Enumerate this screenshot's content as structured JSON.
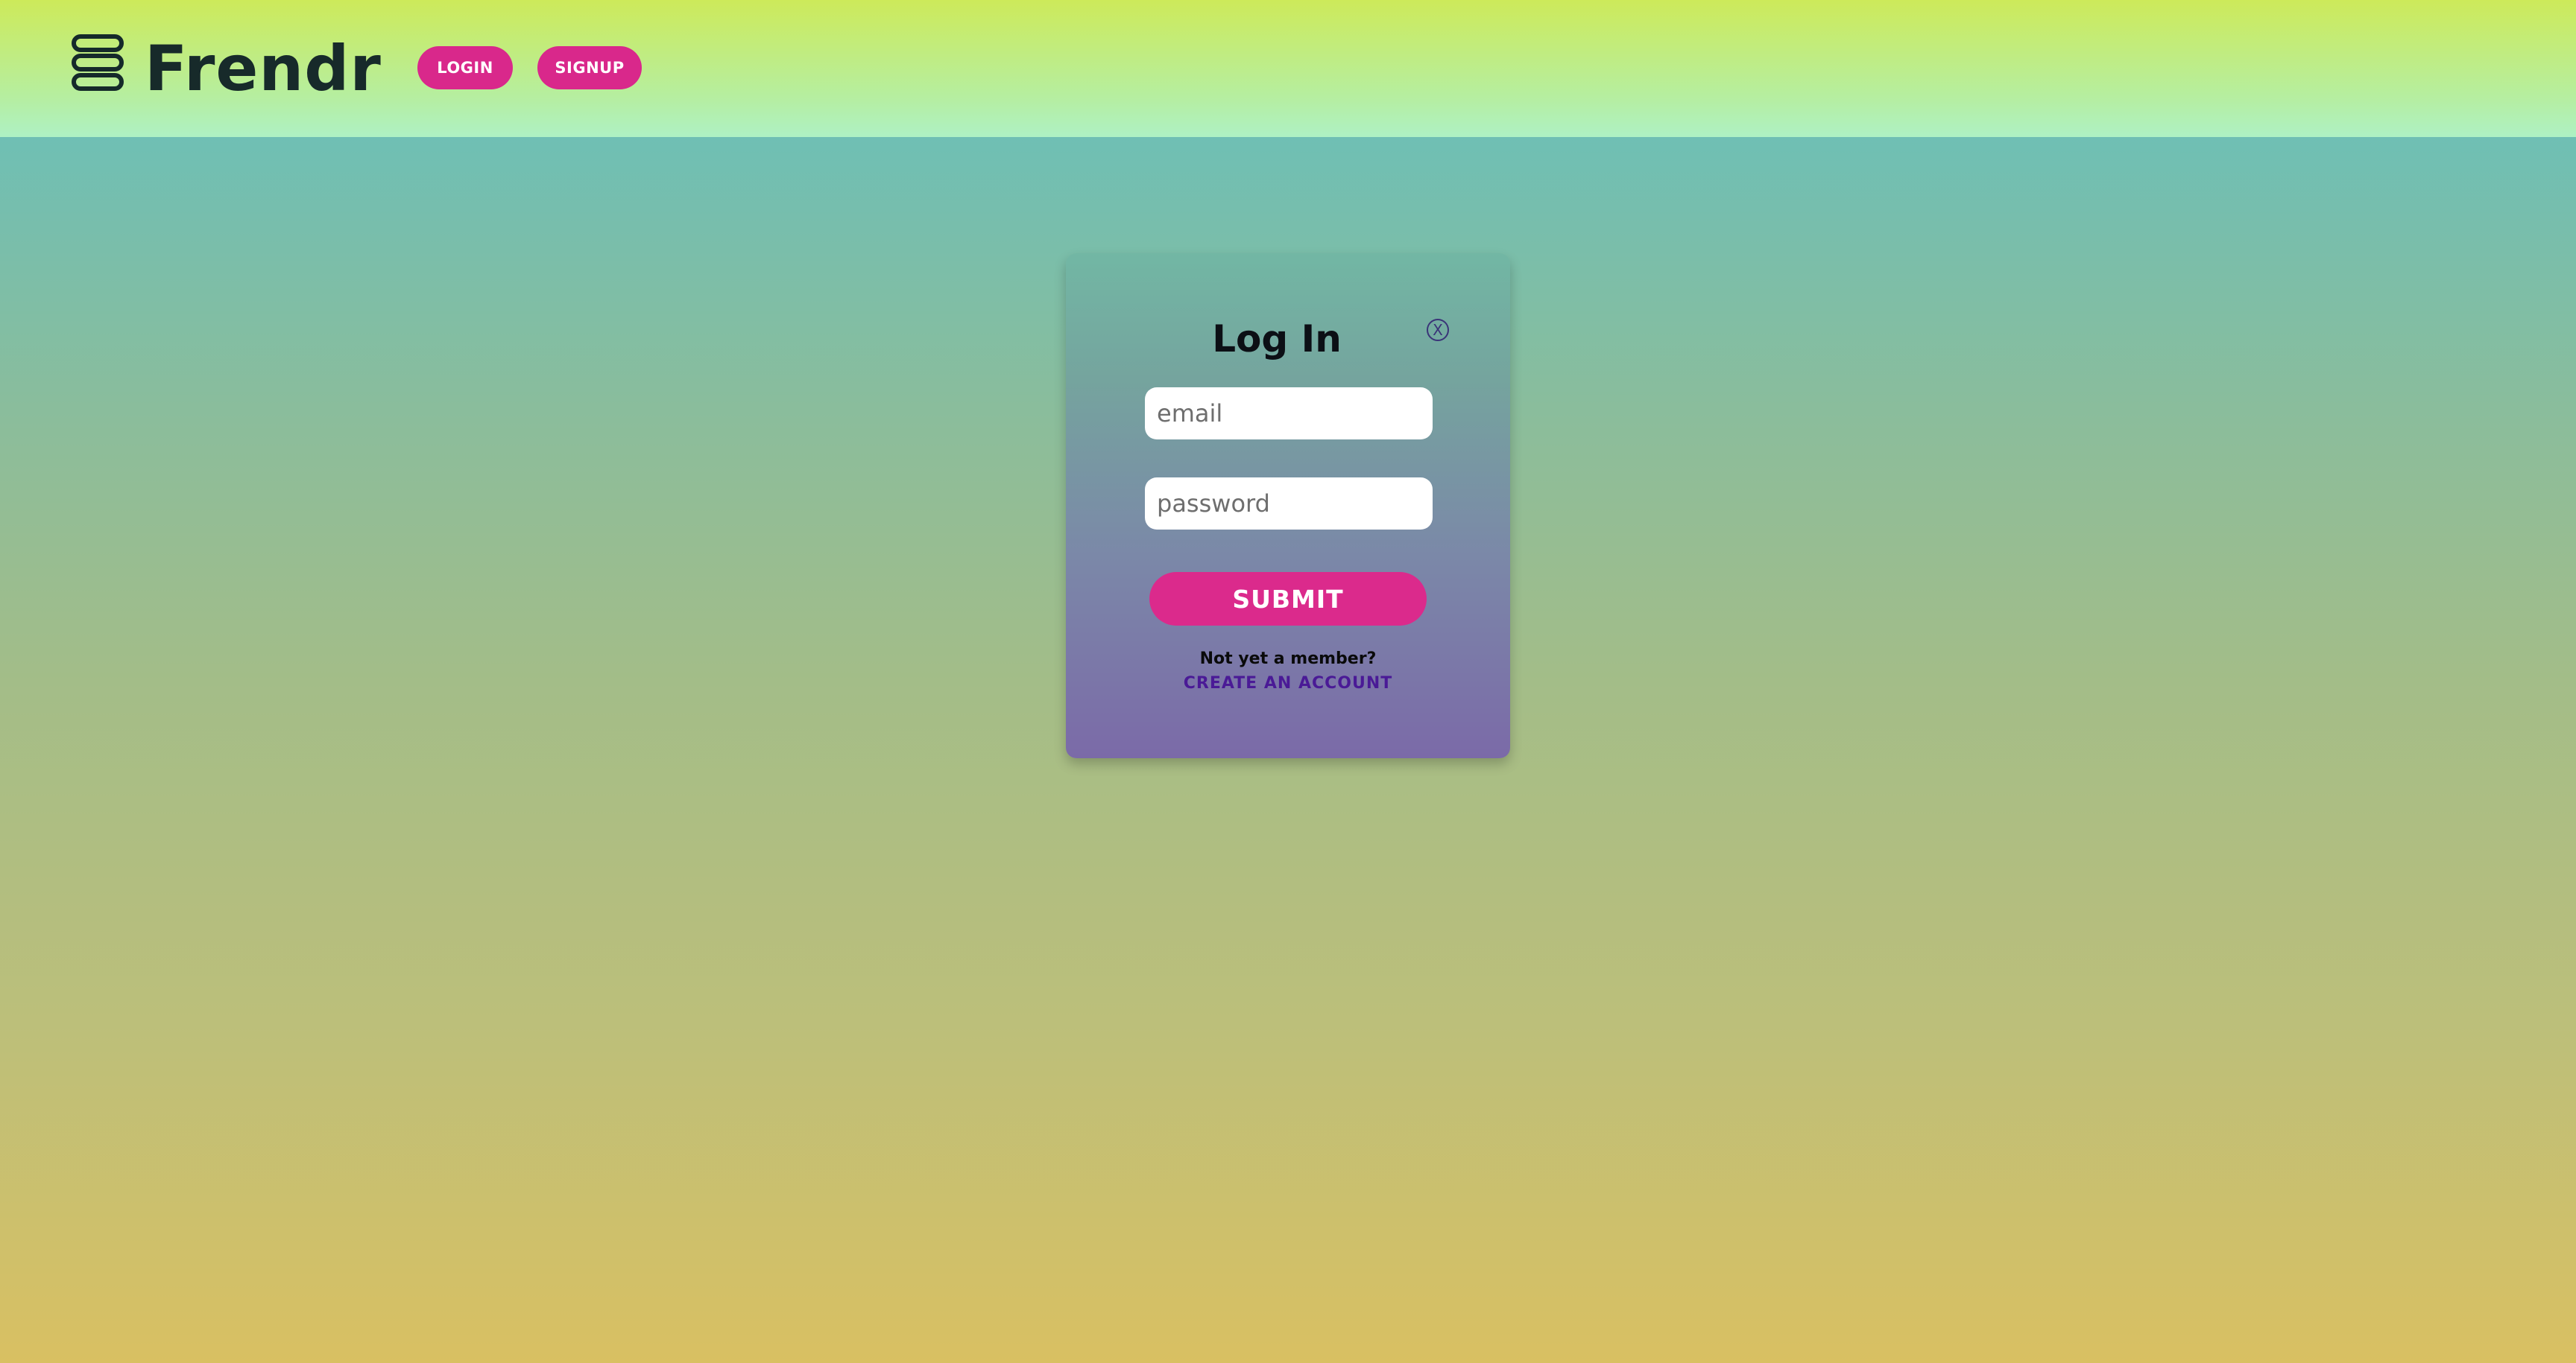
{
  "header": {
    "brand": "Frendr",
    "menu_icon": "hamburger-menu-icon",
    "nav": {
      "login_label": "LOGIN",
      "signup_label": "SIGNUP"
    }
  },
  "login_modal": {
    "title": "Log In",
    "close_label": "X",
    "email": {
      "value": "",
      "placeholder": "email"
    },
    "password": {
      "value": "",
      "placeholder": "password"
    },
    "submit_label": "SUBMIT",
    "member_prompt": "Not yet a member?",
    "create_account_label": "CREATE AN ACCOUNT"
  },
  "colors": {
    "accent": "#d9288b",
    "link": "#4a1a96",
    "brand_text": "#172a2a"
  }
}
